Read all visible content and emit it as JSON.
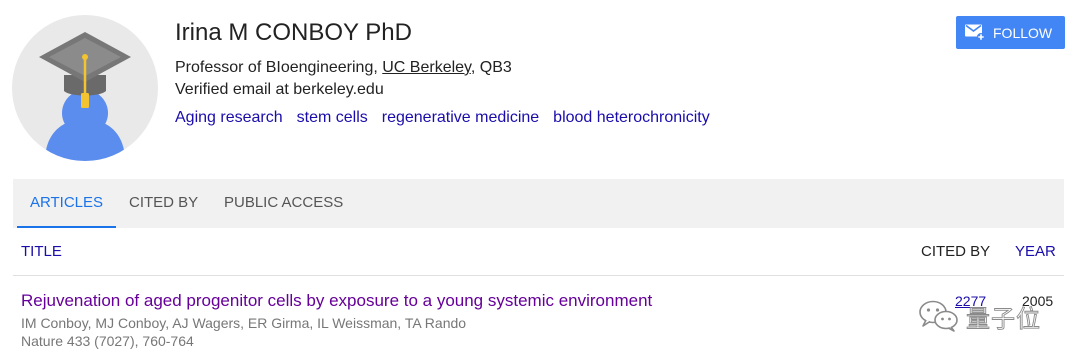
{
  "profile": {
    "name": "Irina M CONBOY PhD",
    "affiliation_prefix": "Professor of BIoengineering, ",
    "affiliation_link": "UC Berkeley",
    "affiliation_suffix": ", QB3",
    "email": "Verified email at berkeley.edu",
    "interests": [
      "Aging research",
      "stem cells",
      "regenerative medicine",
      "blood heterochronicity"
    ]
  },
  "follow_label": "FOLLOW",
  "tabs": [
    "ARTICLES",
    "CITED BY",
    "PUBLIC ACCESS"
  ],
  "active_tab": "ARTICLES",
  "table_headers": {
    "title": "TITLE",
    "cited_by": "CITED BY",
    "year": "YEAR"
  },
  "articles": [
    {
      "title": "Rejuvenation of aged progenitor cells by exposure to a young systemic environment",
      "authors": "IM Conboy, MJ Conboy, AJ Wagers, ER Girma, IL Weissman, TA Rando",
      "venue": "Nature 433 (7027), 760-764",
      "cited_by": "2277",
      "year": "2005"
    }
  ],
  "watermark": {
    "text": "量子位",
    "icon": "wechat-icon"
  },
  "colors": {
    "link": "#1a0dab",
    "visited_title": "#660099",
    "accent": "#1a73e8",
    "follow_button": "#4285f4"
  }
}
